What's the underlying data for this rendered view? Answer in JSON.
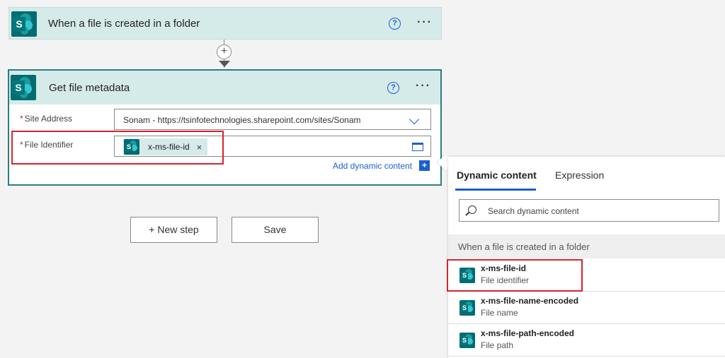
{
  "trigger": {
    "title": "When a file is created in a folder"
  },
  "action": {
    "title": "Get file metadata",
    "site_address": {
      "label": "Site Address",
      "value": "Sonam - https://tsinfotechnologies.sharepoint.com/sites/Sonam"
    },
    "file_identifier": {
      "label": "File Identifier",
      "token": "x-ms-file-id"
    },
    "add_dynamic": "Add dynamic content"
  },
  "buttons": {
    "new_step": "+ New step",
    "save": "Save"
  },
  "panel": {
    "tabs": [
      "Dynamic content",
      "Expression"
    ],
    "search_placeholder": "Search dynamic content",
    "section": "When a file is created in a folder",
    "items": [
      {
        "name": "x-ms-file-id",
        "desc": "File identifier"
      },
      {
        "name": "x-ms-file-name-encoded",
        "desc": "File name"
      },
      {
        "name": "x-ms-file-path-encoded",
        "desc": "File path"
      }
    ]
  },
  "colors": {
    "header_bg": "#d5ebe9",
    "accent": "#1b5fcf",
    "highlight": "#d9232e",
    "sharepoint": "#036c70"
  }
}
